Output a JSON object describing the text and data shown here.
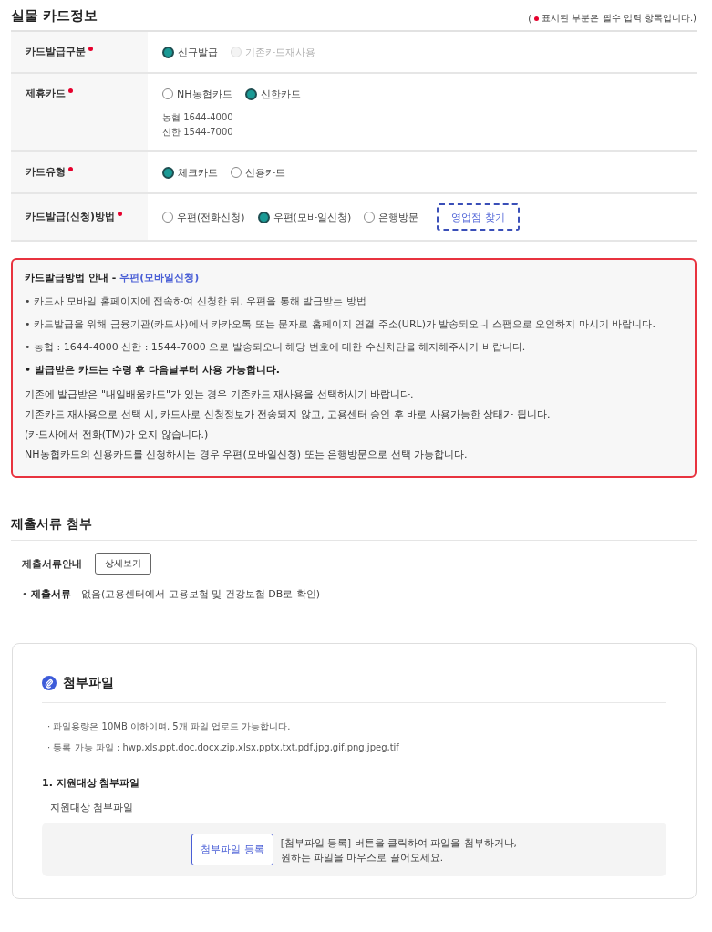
{
  "card_info": {
    "title": "실물 카드정보",
    "required_note": {
      "open": "(",
      "text": "표시된 부분은 필수 입력 항목입니다.)"
    },
    "rows": [
      {
        "label": "카드발급구분",
        "required": true,
        "options": [
          {
            "label": "신규발급",
            "selected": true,
            "disabled": false
          },
          {
            "label": "기존카드재사용",
            "selected": false,
            "disabled": true
          }
        ]
      },
      {
        "label": "제휴카드",
        "required": true,
        "options": [
          {
            "label": "NH농협카드",
            "selected": false,
            "disabled": false
          },
          {
            "label": "신한카드",
            "selected": true,
            "disabled": false
          }
        ],
        "notes": [
          "농협 1644-4000",
          "신한 1544-7000"
        ]
      },
      {
        "label": "카드유형",
        "required": true,
        "options": [
          {
            "label": "체크카드",
            "selected": true,
            "disabled": false
          },
          {
            "label": "신용카드",
            "selected": false,
            "disabled": false
          }
        ]
      },
      {
        "label": "카드발급(신청)방법",
        "required": true,
        "options": [
          {
            "label": "우편(전화신청)",
            "selected": false,
            "disabled": false
          },
          {
            "label": "우편(모바일신청)",
            "selected": true,
            "disabled": false
          },
          {
            "label": "은행방문",
            "selected": false,
            "disabled": false
          }
        ],
        "button": {
          "label": "영업점 찾기",
          "focused": true
        }
      }
    ]
  },
  "method_guide": {
    "title": "카드발급방법 안내 -",
    "method": "우편(모바일신청)",
    "bullets": [
      {
        "text": "• 카드사 모바일 홈페이지에 접속하여 신청한 뒤, 우편을 통해 발급받는 방법",
        "strong": false
      },
      {
        "text": "• 카드발급을 위해 금융기관(카드사)에서 카카오톡 또는 문자로 홈페이지 연결 주소(URL)가 발송되오니 스팸으로 오인하지 마시기 바랍니다.",
        "strong": false
      },
      {
        "text": "• 농협 : 1644-4000 신한 : 1544-7000 으로 발송되오니 해당 번호에 대한 수신차단을 해지해주시기 바랍니다.",
        "strong": false
      },
      {
        "text": "• 발급받은 카드는 수령 후 다음날부터 사용 가능합니다.",
        "strong": true
      }
    ],
    "lines": [
      "기존에 발급받은 \"내일배움카드\"가 있는 경우 기존카드 재사용을 선택하시기 바랍니다.",
      "기존카드 재사용으로 선택 시, 카드사로 신청정보가 전송되지 않고, 고용센터 승인 후 바로 사용가능한 상태가 됩니다.",
      "(카드사에서 전화(TM)가 오지 않습니다.)",
      "NH농협카드의 신용카드를 신청하시는 경우 우편(모바일신청) 또는 은행방문으로 선택 가능합니다."
    ]
  },
  "documents": {
    "title": "제출서류 첨부",
    "guide_label": "제출서류안내",
    "detail_button": "상세보기",
    "items": [
      "• **제출서류** - 없음(고용센터에서 고용보험 및 건강보험 DB로 확인)"
    ]
  },
  "attachments": {
    "title": "첨부파일",
    "rules": [
      "· 파일용량은 10MB 이하이며, 5개 파일 업로드 가능합니다.",
      "· 등록 가능 파일 : hwp,xls,ppt,doc,docx,zip,xlsx,pptx,txt,pdf,jpg,gif,png,jpeg,tif"
    ],
    "groups": [
      {
        "heading": "1. 지원대상 첨부파일",
        "label": "지원대상 첨부파일",
        "upload_button": "첨부파일 등록",
        "hint_lines": [
          "[첨부파일 등록] 버튼을 클릭하여 파일을 첨부하거나,",
          "원하는 파일을 마우스로 끌어오세요."
        ]
      }
    ]
  }
}
